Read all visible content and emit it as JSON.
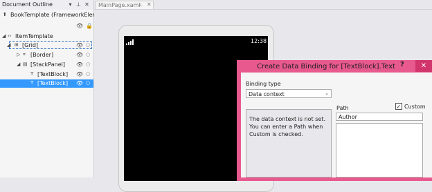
{
  "outline": {
    "title": "Document Outline",
    "root": "BookTemplate (FrameworkElem...",
    "items": [
      {
        "label": "ItemTemplate"
      },
      {
        "label": "[Grid]"
      },
      {
        "label": "[Border]"
      },
      {
        "label": "[StackPanel]"
      },
      {
        "label": "[TextBlock]"
      },
      {
        "label": "[TextBlock]"
      }
    ]
  },
  "tab": {
    "label": "MainPage.xaml"
  },
  "phone": {
    "time": "12:38"
  },
  "dialog": {
    "title": "Create Data Binding for [TextBlock].Text",
    "help": "?",
    "close": "✕",
    "binding_type_label": "Binding type",
    "binding_type_value": "Data context",
    "info": "The data context is not set. You can enter a Path when Custom is checked.",
    "path_label": "Path",
    "custom_label": "Custom",
    "custom_checked": true,
    "path_value": "Author"
  },
  "colors": {
    "selection": "#3399ff",
    "dialog_title_bar": "#e8598e",
    "dialog_close": "#d2356c"
  }
}
